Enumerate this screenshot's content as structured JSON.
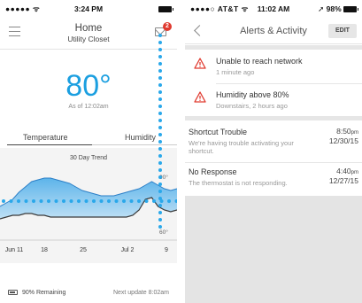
{
  "left": {
    "statusbar": {
      "signal": "●●●●● ᯤ",
      "time": "3:24 PM"
    },
    "header": {
      "title": "Home",
      "subtitle": "Utility Closet",
      "badge_count": "2"
    },
    "temperature": {
      "value": "80°",
      "as_of": "As of 12:02am"
    },
    "tabs": [
      {
        "label": "Temperature",
        "active": true
      },
      {
        "label": "Humidity",
        "active": false
      }
    ],
    "chart_data": {
      "type": "area",
      "title": "30 Day Trend",
      "x_tick_labels": [
        "Jun 11",
        "18",
        "25",
        "Jul 2",
        "9"
      ],
      "y_tick_labels": [
        "90°",
        "60°"
      ],
      "ylim": [
        55,
        95
      ],
      "x": [
        0,
        1,
        2,
        3,
        4,
        5,
        6,
        7,
        8,
        9,
        10,
        11,
        12,
        13,
        14,
        15,
        16,
        17,
        18,
        19,
        20,
        21,
        22,
        23,
        24,
        25,
        26,
        27,
        28
      ],
      "series": [
        {
          "values": [
            72,
            74,
            76,
            80,
            83,
            86,
            87,
            88,
            88,
            87,
            86,
            85,
            83,
            81,
            80,
            79,
            78,
            78,
            78,
            79,
            80,
            81,
            82,
            84,
            86,
            84,
            82,
            81,
            82
          ]
        },
        {
          "values": [
            65,
            66,
            67,
            67,
            68,
            68,
            67,
            67,
            66,
            66,
            66,
            66,
            66,
            66,
            66,
            66,
            66,
            66,
            66,
            66,
            66,
            67,
            70,
            76,
            77,
            72,
            70,
            69,
            70
          ]
        }
      ],
      "threshold": 75,
      "colors": {
        "fill": "#bfe0f5",
        "fill_top": "#5db4ea",
        "line_low": "#3a3a3a",
        "line_high": "#2c7fc7",
        "threshold": "#2aa8ea"
      }
    },
    "footer": {
      "battery": "90% Remaining",
      "next_update": "Next update 8:02am"
    }
  },
  "right": {
    "statusbar": {
      "carrier": "●●●●○ AT&T ᯤ",
      "time": "11:02 AM",
      "battery": "➚ 98%"
    },
    "header": {
      "title": "Alerts & Activity",
      "edit_label": "EDIT"
    },
    "alerts": [
      {
        "title": "Unable to reach network",
        "subtitle": "1 minute ago"
      },
      {
        "title": "Humidity above 80%",
        "subtitle": "Downstairs, 2 hours ago"
      }
    ],
    "notifications": [
      {
        "title": "Shortcut Trouble",
        "subtitle": "We're having trouble activating your shortcut.",
        "time": "8:50",
        "ampm": "pm",
        "date": "12/30/15"
      },
      {
        "title": "No Response",
        "subtitle": "The thermostat is not responding.",
        "time": "4:40",
        "ampm": "pm",
        "date": "12/27/15"
      }
    ],
    "colors": {
      "warning": "#e03a2f"
    }
  }
}
